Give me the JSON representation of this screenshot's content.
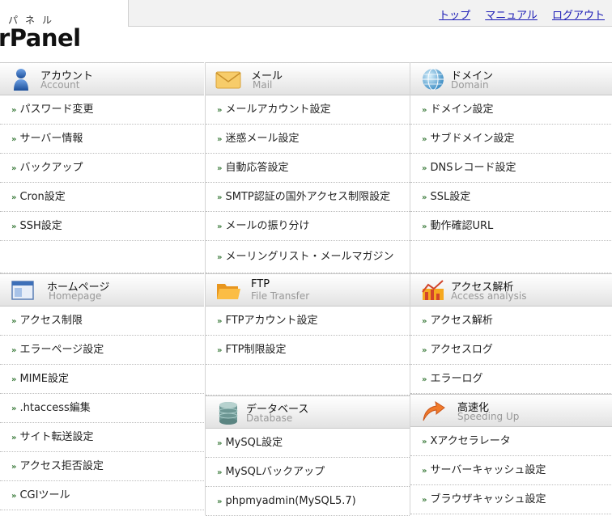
{
  "header": {
    "furigana": "パネル",
    "brand": "rPanel",
    "links": [
      "トップ",
      "マニュアル",
      "ログアウト"
    ]
  },
  "sections": {
    "account": {
      "title": "アカウント",
      "subtitle": "Account",
      "items": [
        "パスワード変更",
        "サーバー情報",
        "バックアップ",
        "Cron設定",
        "SSH設定"
      ]
    },
    "mail": {
      "title": "メール",
      "subtitle": "Mail",
      "items": [
        "メールアカウント設定",
        "迷惑メール設定",
        "自動応答設定",
        "SMTP認証の国外アクセス制限設定",
        "メールの振り分け",
        "メーリングリスト・メールマガジン"
      ]
    },
    "domain": {
      "title": "ドメイン",
      "subtitle": "Domain",
      "items": [
        "ドメイン設定",
        "サブドメイン設定",
        "DNSレコード設定",
        "SSL設定",
        "動作確認URL"
      ]
    },
    "homepage": {
      "title": "ホームページ",
      "subtitle": "Homepage",
      "items": [
        "アクセス制限",
        "エラーページ設定",
        "MIME設定",
        ".htaccess編集",
        "サイト転送設定",
        "アクセス拒否設定",
        "CGIツール"
      ]
    },
    "ftp": {
      "title": "FTP",
      "subtitle": "File Transfer",
      "items": [
        "FTPアカウント設定",
        "FTP制限設定"
      ]
    },
    "access": {
      "title": "アクセス解析",
      "subtitle": "Access analysis",
      "items": [
        "アクセス解析",
        "アクセスログ",
        "エラーログ"
      ]
    },
    "database": {
      "title": "データベース",
      "subtitle": "Database",
      "items": [
        "MySQL設定",
        "MySQLバックアップ",
        "phpmyadmin(MySQL5.7)"
      ]
    },
    "speed": {
      "title": "高速化",
      "subtitle": "Speeding Up",
      "items": [
        "Xアクセラレータ",
        "サーバーキャッシュ設定",
        "ブラウザキャッシュ設定"
      ]
    }
  },
  "icons": {
    "account": "user-icon",
    "mail": "envelope-icon",
    "domain": "globe-icon",
    "homepage": "browser-window-icon",
    "ftp": "folder-icon",
    "access": "chart-icon",
    "database": "database-icon",
    "speed": "speed-arrow-icon",
    "item": "double-chevron-icon"
  },
  "colors": {
    "link": "#1a1ab5",
    "header_bg": "#e2e2e2"
  }
}
